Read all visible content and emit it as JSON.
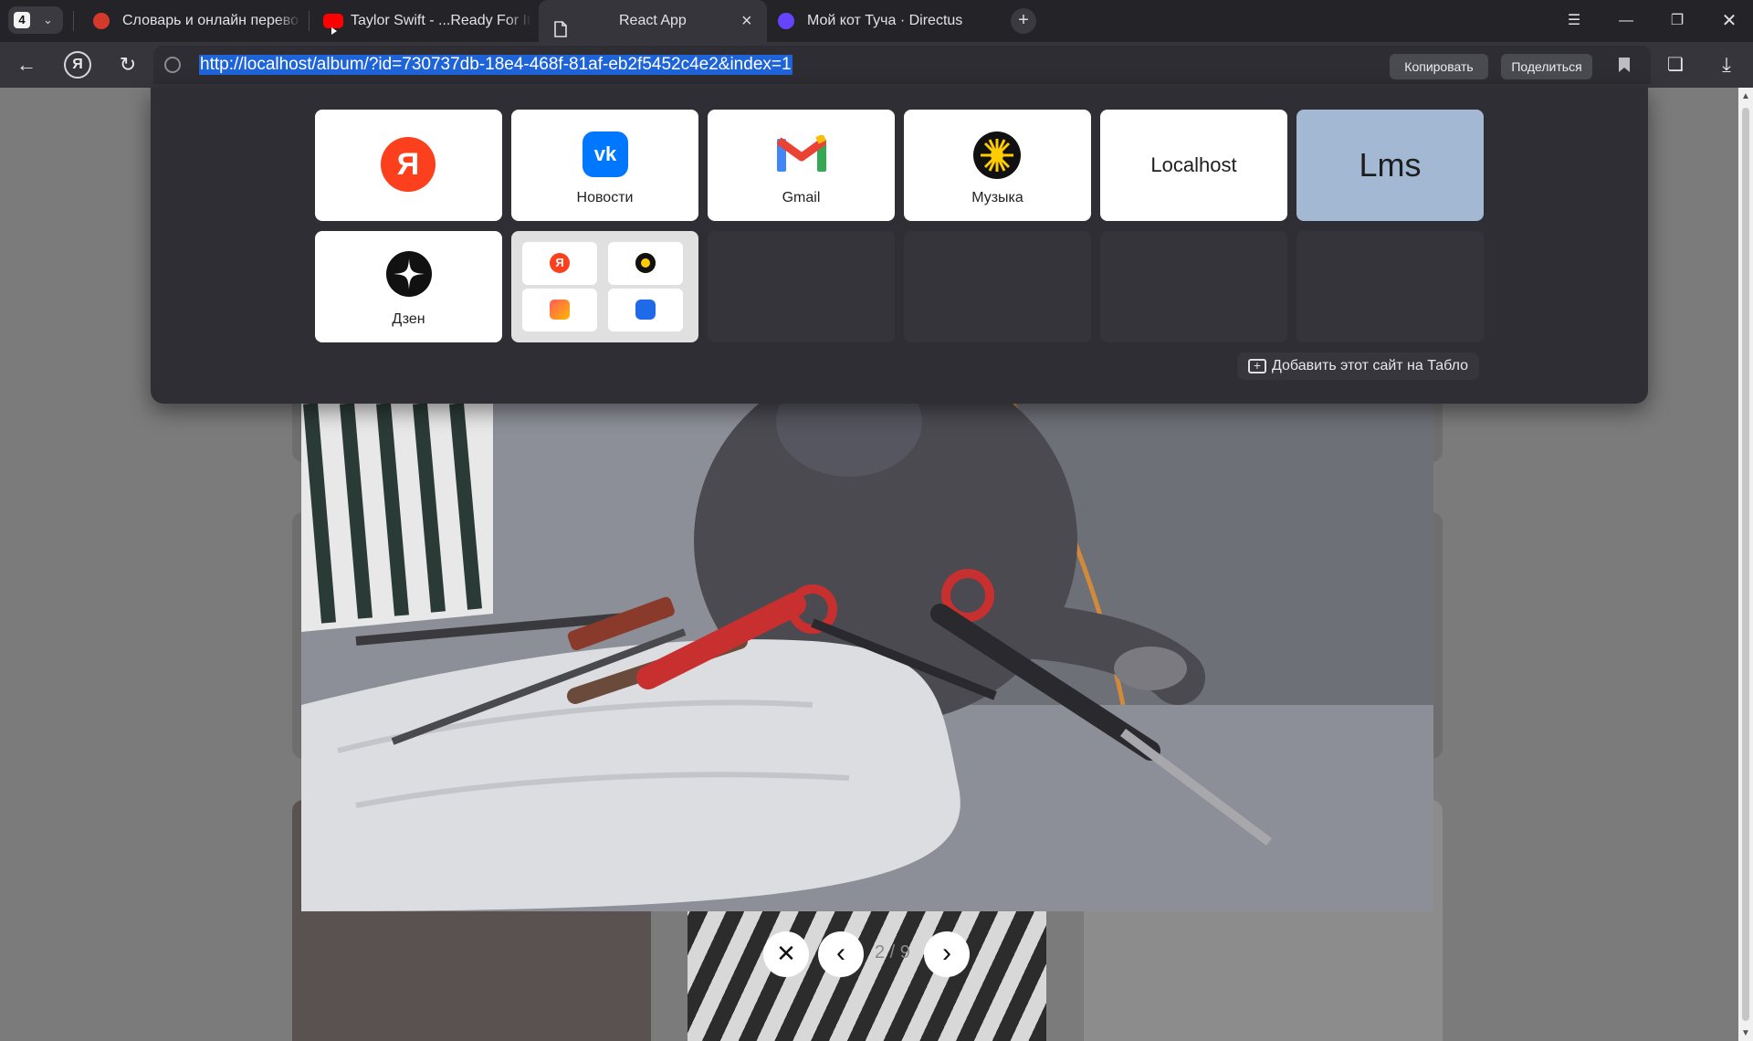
{
  "tabs": {
    "count": "4",
    "items": [
      {
        "title": "Словарь и онлайн перево"
      },
      {
        "title": "Taylor Swift - ...Ready For It"
      },
      {
        "title": "React App"
      },
      {
        "title": "Мой кот Туча · Directus"
      }
    ]
  },
  "addressbar": {
    "url": "http://localhost/album/?id=730737db-18e4-468f-81af-eb2f5452c4e2&index=1",
    "copy_label": "Копировать",
    "share_label": "Поделиться"
  },
  "tablo": {
    "tiles": [
      {
        "label": ""
      },
      {
        "label": "Новости"
      },
      {
        "label": "Gmail"
      },
      {
        "label": "Музыка"
      },
      {
        "label": "Localhost"
      },
      {
        "label": "Lms"
      },
      {
        "label": "Дзен"
      }
    ],
    "add_site_label": "Добавить этот сайт на Табло",
    "yandex_letter": "Я"
  },
  "lightbox": {
    "counter": "2 / 9"
  },
  "colors": {
    "selection": "#1e64d8",
    "lms_tile": "#a3b8d2",
    "yandex_red": "#fc3f1d",
    "vk_blue": "#0077ff"
  }
}
